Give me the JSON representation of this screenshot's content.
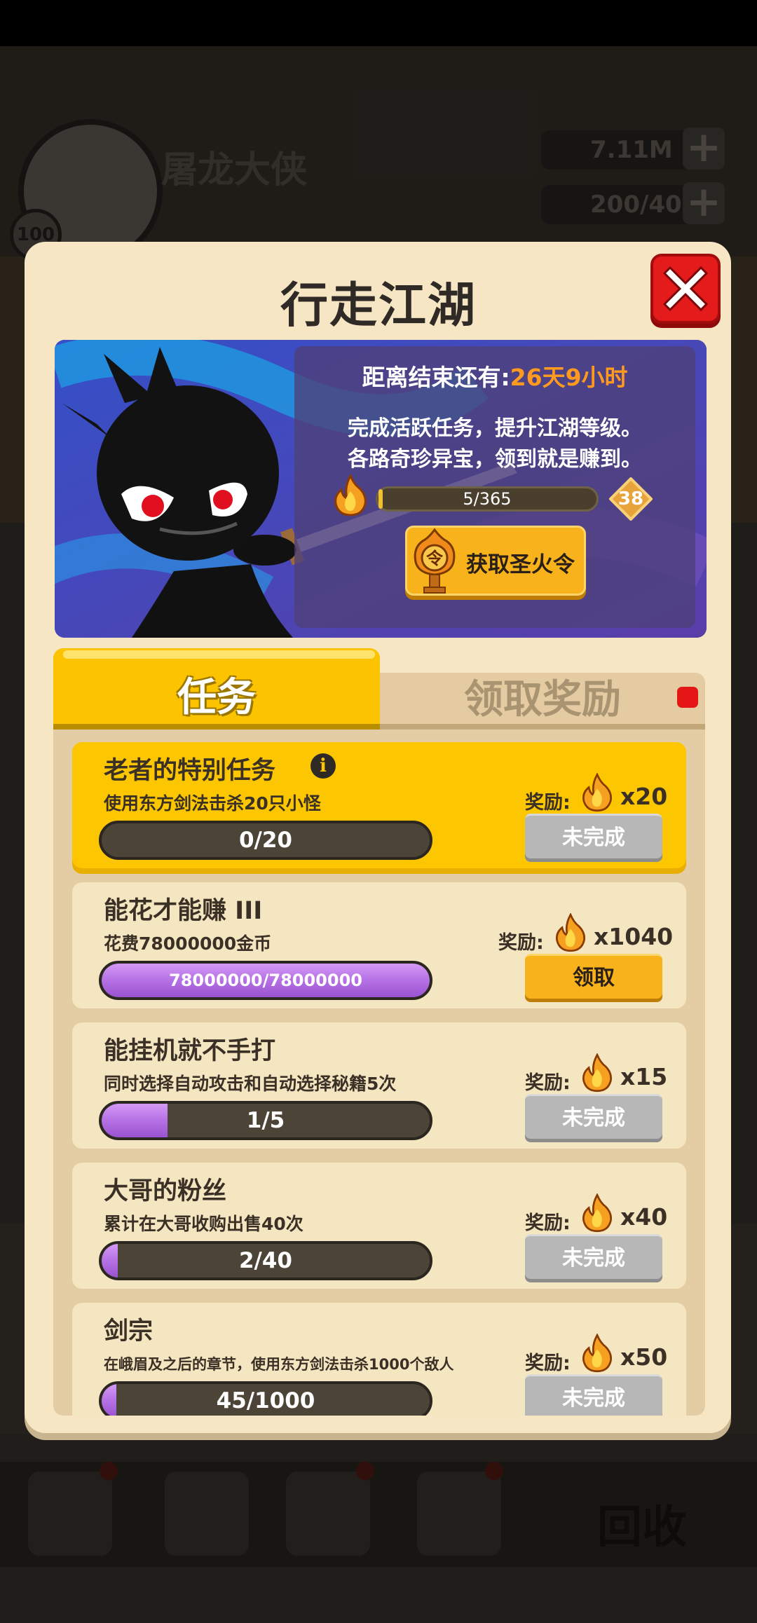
{
  "background": {
    "player_name": "屠龙大侠",
    "player_level": "100",
    "gold": "7.11M",
    "gems": "200/40",
    "recycle_label": "回收"
  },
  "modal": {
    "title": "行走江湖",
    "countdown_prefix": "距离结束还有:",
    "countdown_value": "26天9小时",
    "desc_line1": "完成活跃任务，提升江湖等级。",
    "desc_line2": "各路奇珍异宝，领到就是赚到。",
    "xp_text": "5/365",
    "xp_fraction": 0.014,
    "level": "38",
    "get_token_label": "获取圣火令",
    "token_glyph": "令"
  },
  "tabs": {
    "task": "任务",
    "reward": "领取奖励"
  },
  "reward_label": "奖励:",
  "tasks": [
    {
      "title": "老者的特别任务",
      "desc": "使用东方剑法击杀20只小怪",
      "progress": "0/20",
      "fraction": 0.0,
      "reward": "x20",
      "button": "未完成",
      "state": "active"
    },
    {
      "title": "能花才能赚 III",
      "desc": "花费78000000金币",
      "progress": "78000000/78000000",
      "fraction": 1.0,
      "reward": "x1040",
      "button": "领取",
      "state": "claim"
    },
    {
      "title": "能挂机就不手打",
      "desc": "同时选择自动攻击和自动选择秘籍5次",
      "progress": "1/5",
      "fraction": 0.2,
      "reward": "x15",
      "button": "未完成",
      "state": "incomplete"
    },
    {
      "title": "大哥的粉丝",
      "desc": "累计在大哥收购出售40次",
      "progress": "2/40",
      "fraction": 0.05,
      "reward": "x40",
      "button": "未完成",
      "state": "incomplete"
    },
    {
      "title": "剑宗",
      "desc": "在峨眉及之后的章节，使用东方剑法击杀1000个敌人",
      "progress": "45/1000",
      "fraction": 0.045,
      "reward": "x50",
      "button": "未完成",
      "state": "incomplete"
    }
  ],
  "icons": {
    "close": "close-icon",
    "flame": "flame-icon",
    "info": "info-icon",
    "token": "fire-token-icon"
  },
  "colors": {
    "accent_yellow": "#fcc600",
    "countdown_orange": "#ff9a1f",
    "close_red": "#e31b1b",
    "progress_purple": "#b874e6"
  }
}
